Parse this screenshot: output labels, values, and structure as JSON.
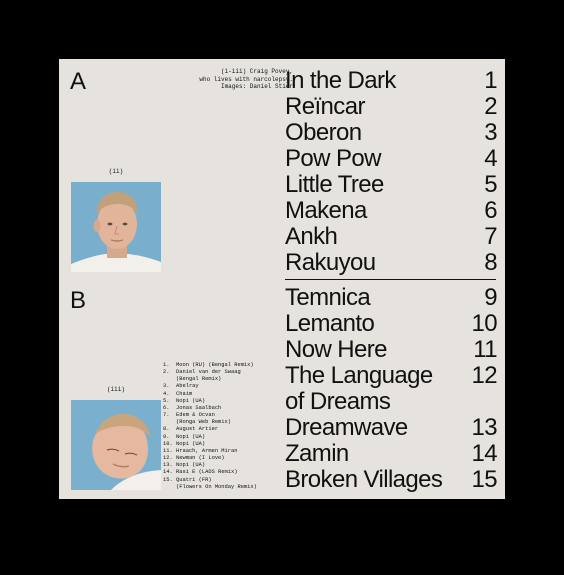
{
  "side_a": {
    "letter": "A",
    "credit": [
      "(i-iii) Craig Povey,",
      "who lives with narcolepsy.",
      "Images: Daniel Stier"
    ],
    "photo_caption": "(ii)",
    "tracks": [
      {
        "title": "In the Dark",
        "num": "1"
      },
      {
        "title": "Reïncar",
        "num": "2"
      },
      {
        "title": "Oberon",
        "num": "3"
      },
      {
        "title": "Pow Pow",
        "num": "4"
      },
      {
        "title": "Little Tree",
        "num": "5"
      },
      {
        "title": "Makena",
        "num": "6"
      },
      {
        "title": "Ankh",
        "num": "7"
      },
      {
        "title": "Rakuyou",
        "num": "8"
      }
    ]
  },
  "side_b": {
    "letter": "B",
    "photo_caption": "(iii)",
    "tracks": [
      {
        "title": "Temnica",
        "num": "9"
      },
      {
        "title": "Lemanto",
        "num": "10"
      },
      {
        "title": "Now Here",
        "num": "11"
      },
      {
        "title": "The Language of Dreams",
        "num": "12"
      },
      {
        "title": "Dreamwave",
        "num": "13"
      },
      {
        "title": "Zamin",
        "num": "14"
      },
      {
        "title": "Broken Villages",
        "num": "15"
      }
    ],
    "artists": [
      {
        "n": "1.",
        "name": "Moon (RU) (Bengal Remix)"
      },
      {
        "n": "2.",
        "name": "Daniel van der Swaag",
        "sub": "(Bengal Remix)"
      },
      {
        "n": "3.",
        "name": "Abelray"
      },
      {
        "n": "4.",
        "name": "Chaim"
      },
      {
        "n": "5.",
        "name": "Nopi (UA)"
      },
      {
        "n": "6.",
        "name": "Jonas Saalbach"
      },
      {
        "n": "7.",
        "name": "Edem & Ocvan",
        "sub": "(Ronga Web Remix)"
      },
      {
        "n": "8.",
        "name": "August Artier"
      },
      {
        "n": "9.",
        "name": "Nopi (UA)"
      },
      {
        "n": "10.",
        "name": "Nopi (UA)"
      },
      {
        "n": "11.",
        "name": "Hraach, Armen Miran"
      },
      {
        "n": "12.",
        "name": "Newman (I Love)"
      },
      {
        "n": "13.",
        "name": "Nopi (UA)"
      },
      {
        "n": "14.",
        "name": "Rasi E (LADS Remix)"
      },
      {
        "n": "15.",
        "name": "Quatri (FR)",
        "sub": "(Flowers On Monday Remix)"
      }
    ]
  },
  "colors": {
    "background": "#000000",
    "paper": "#e6e3de",
    "ink": "#111111",
    "photo_sky": "#7fb3cf"
  }
}
